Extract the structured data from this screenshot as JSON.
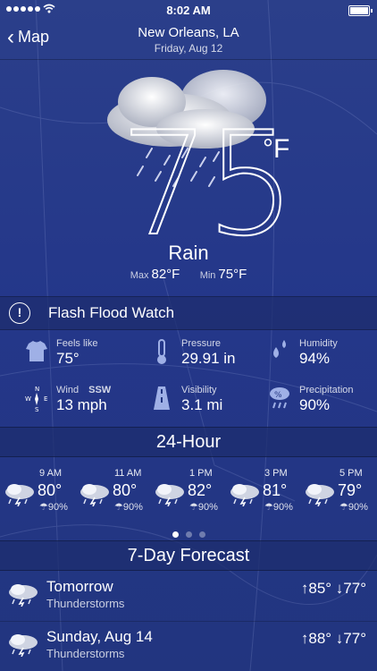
{
  "status": {
    "time": "8:02 AM"
  },
  "nav": {
    "back_label": "Map",
    "city": "New Orleans, LA",
    "date": "Friday, Aug 12"
  },
  "current": {
    "temp": "75",
    "unit": "°F",
    "condition": "Rain",
    "max_label": "Max",
    "max": "82°F",
    "min_label": "Min",
    "min": "75°F"
  },
  "alert": {
    "text": "Flash Flood Watch"
  },
  "details": [
    {
      "label": "Feels like",
      "value": "75°",
      "icon": "shirt-icon"
    },
    {
      "label": "Pressure",
      "value": "29.91 in",
      "icon": "thermometer-icon"
    },
    {
      "label": "Humidity",
      "value": "94%",
      "icon": "droplets-icon"
    },
    {
      "label": "Wind",
      "dir": "SSW",
      "value": "13 mph",
      "icon": "compass-icon"
    },
    {
      "label": "Visibility",
      "value": "3.1 mi",
      "icon": "road-icon"
    },
    {
      "label": "Precipitation",
      "value": "90%",
      "icon": "rain-cloud-icon"
    }
  ],
  "hourly_title": "24-Hour",
  "hourly": [
    {
      "time": "9 AM",
      "temp": "80°",
      "pct": "90%"
    },
    {
      "time": "11 AM",
      "temp": "80°",
      "pct": "90%"
    },
    {
      "time": "1 PM",
      "temp": "82°",
      "pct": "90%"
    },
    {
      "time": "3 PM",
      "temp": "81°",
      "pct": "90%"
    },
    {
      "time": "5 PM",
      "temp": "79°",
      "pct": "90%"
    }
  ],
  "page_dots": {
    "count": 3,
    "active": 1
  },
  "forecast_title": "7-Day Forecast",
  "forecast": [
    {
      "day": "Tomorrow",
      "desc": "Thunderstorms",
      "hilo": "↑85° ↓77°"
    },
    {
      "day": "Sunday, Aug 14",
      "desc": "Thunderstorms",
      "hilo": "↑88° ↓77°"
    }
  ]
}
